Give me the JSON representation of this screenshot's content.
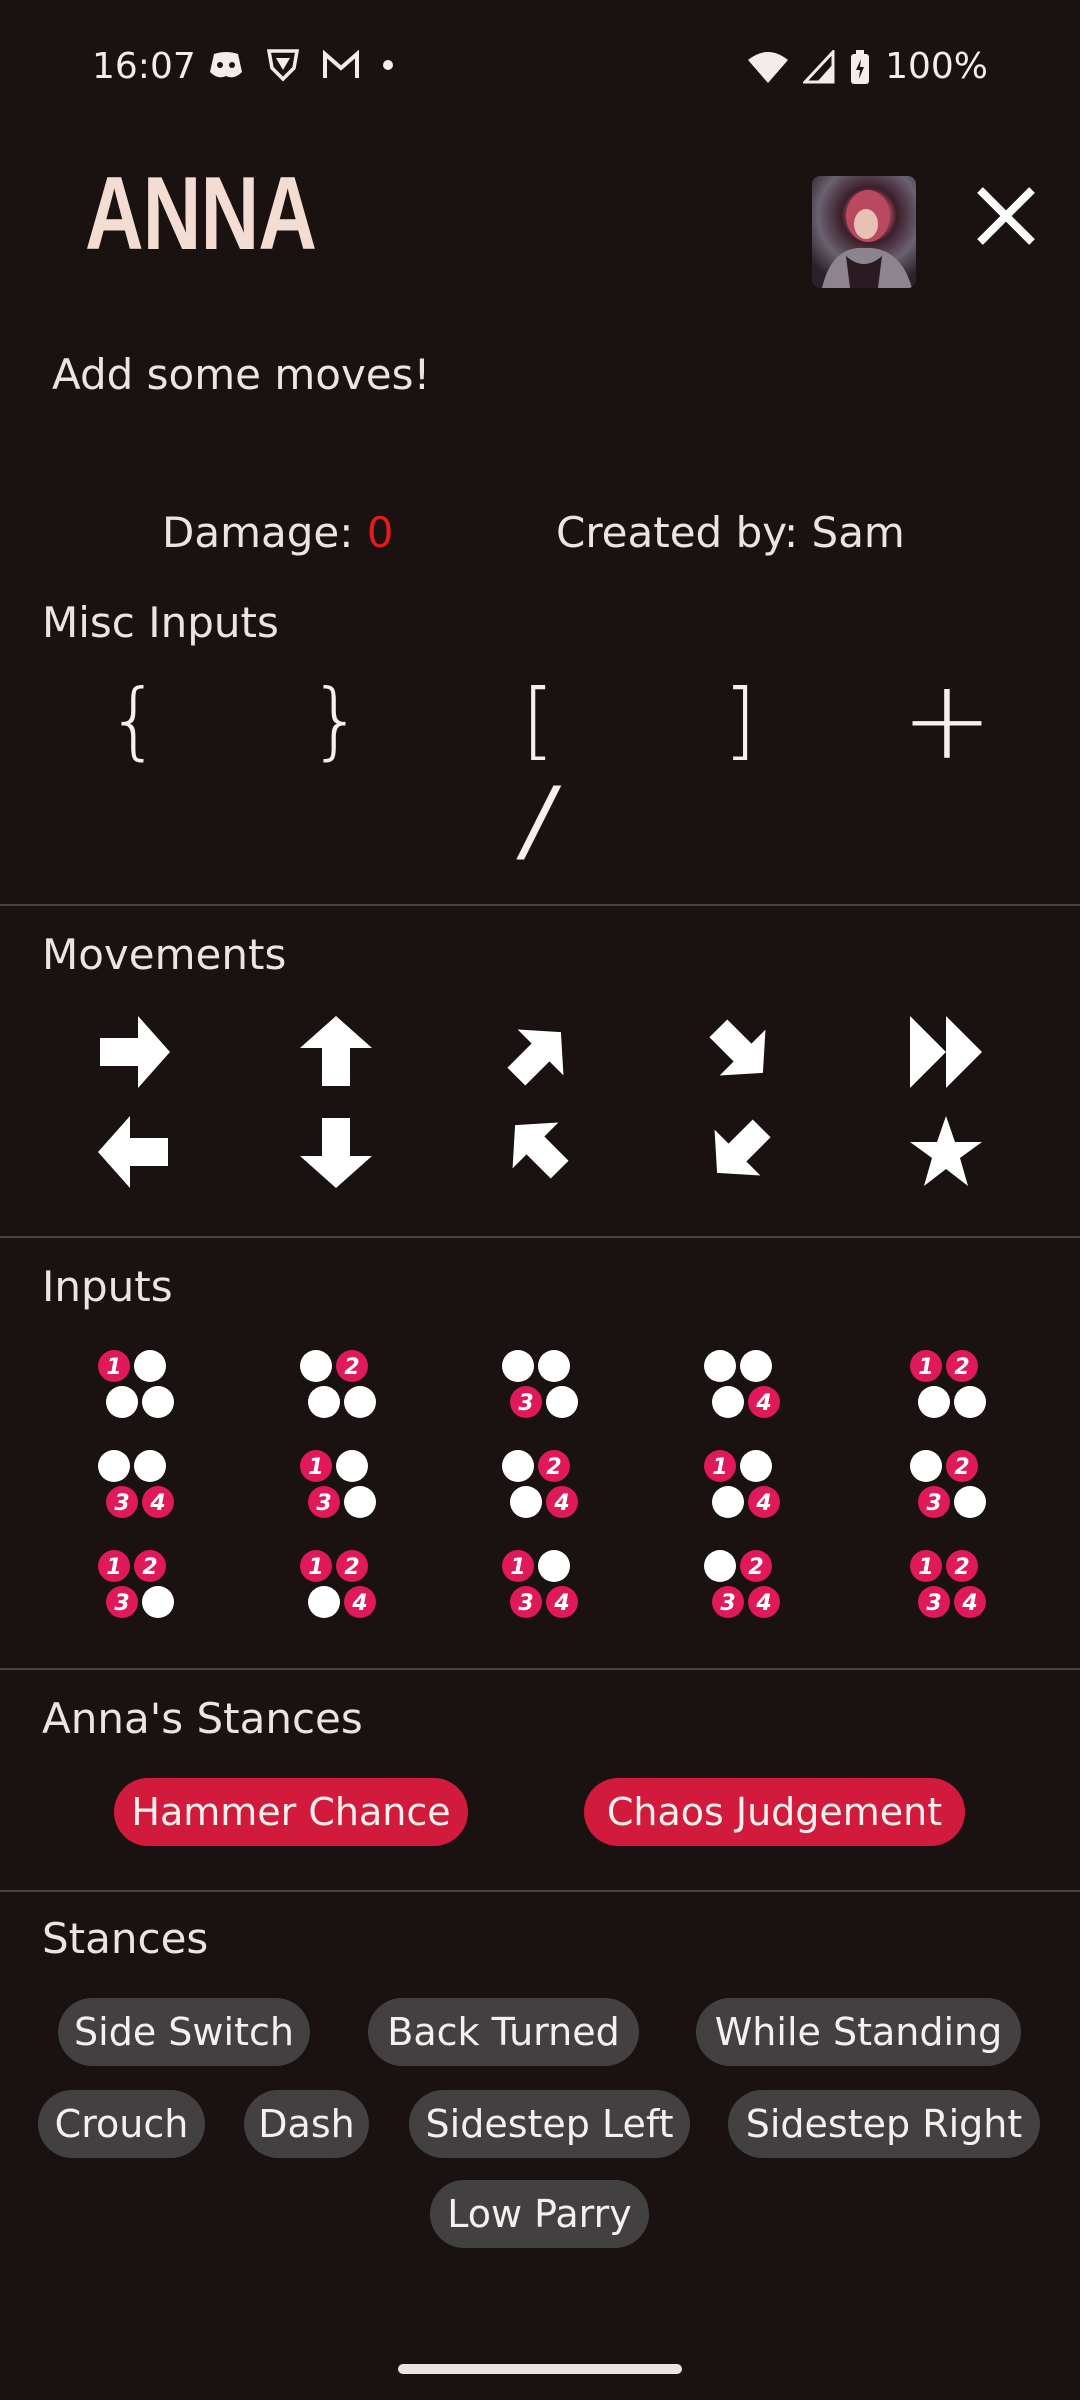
{
  "status_bar": {
    "time": "16:07",
    "battery": "100%",
    "icons_left": [
      "discord-icon",
      "shield-icon",
      "gmail-icon",
      "dot-icon"
    ],
    "icons_right": [
      "wifi-icon",
      "signal-icon",
      "battery-icon"
    ]
  },
  "header": {
    "character_name": "ANNA",
    "subtitle": "Add some moves!"
  },
  "stats": {
    "damage_label": "Damage: ",
    "damage_value": "0",
    "created_by": "Created by: Sam",
    "damage_color": "#e31b1b"
  },
  "sections": {
    "misc": "Misc Inputs",
    "movements": "Movements",
    "inputs": "Inputs",
    "char_stances": "Anna's Stances",
    "stances": "Stances"
  },
  "misc_inputs": [
    "{",
    "}",
    "[",
    "]",
    "+",
    "/"
  ],
  "movements": [
    "forward-arrow-icon",
    "up-arrow-icon",
    "up-forward-arrow-icon",
    "down-forward-arrow-icon",
    "dash-forward-icon",
    "back-arrow-icon",
    "down-arrow-icon",
    "up-back-arrow-icon",
    "down-back-arrow-icon",
    "star-icon"
  ],
  "inputs": [
    [
      "1"
    ],
    [
      "2"
    ],
    [
      "3"
    ],
    [
      "4"
    ],
    [
      "1",
      "2"
    ],
    [
      "3",
      "4"
    ],
    [
      "1",
      "3"
    ],
    [
      "2",
      "4"
    ],
    [
      "1",
      "4"
    ],
    [
      "2",
      "3"
    ],
    [
      "1",
      "2",
      "3"
    ],
    [
      "1",
      "2",
      "4"
    ],
    [
      "1",
      "3",
      "4"
    ],
    [
      "2",
      "3",
      "4"
    ],
    [
      "1",
      "2",
      "3",
      "4"
    ]
  ],
  "char_stances": [
    "Hammer Chance",
    "Chaos Judgement"
  ],
  "stances": [
    "Side Switch",
    "Back Turned",
    "While Standing",
    "Crouch",
    "Dash",
    "Sidestep Left",
    "Sidestep Right",
    "Low Parry"
  ],
  "colors": {
    "background": "#1a1111",
    "accent": "#d21a3c",
    "button_pink": "#e0195a",
    "chip_grey": "#424040"
  }
}
